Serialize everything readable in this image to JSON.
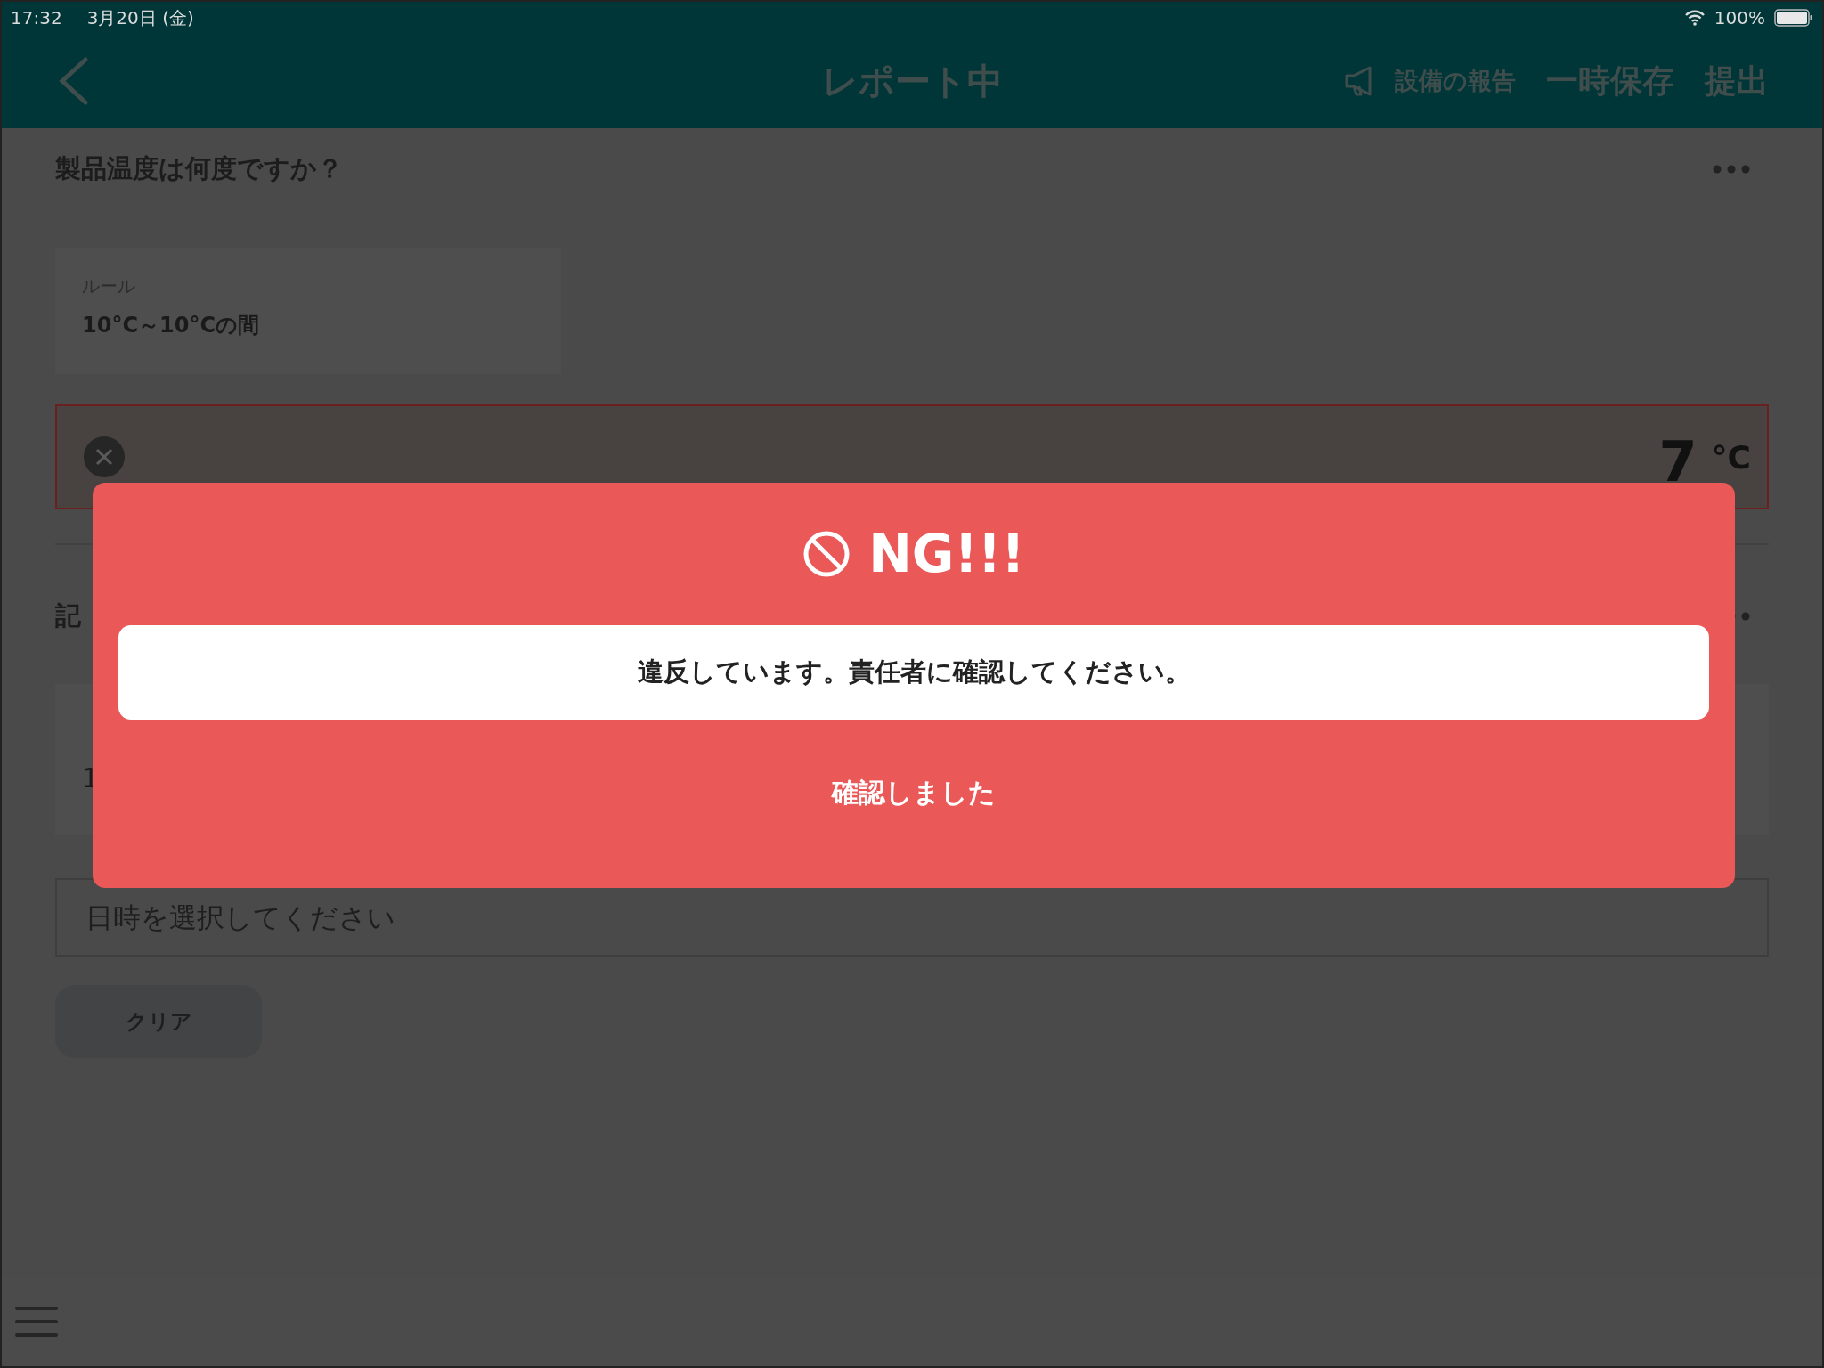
{
  "status_bar": {
    "time": "17:32",
    "date": "3月20日 (金)",
    "battery": "100%"
  },
  "nav_bar": {
    "title": "レポート中",
    "actions": [
      {
        "kind": "icon-text",
        "label": "設備の報告"
      },
      {
        "kind": "text",
        "label": "一時保存"
      },
      {
        "kind": "text",
        "label": "提出"
      }
    ]
  },
  "questions": [
    {
      "title": "製品温度は何度ですか？",
      "rule_label": "ルール",
      "rule_value": "10°C～10°Cの間",
      "answer": {
        "value": "7",
        "unit": "°C",
        "error": true
      }
    },
    {
      "title": "記",
      "rule_value": "1",
      "date_placeholder": "日時を選択してください",
      "clear_button": "クリア"
    }
  ],
  "dialog": {
    "title": "NG!!!",
    "message": "違反しています。責任者に確認してください。",
    "button": "確認しました"
  }
}
